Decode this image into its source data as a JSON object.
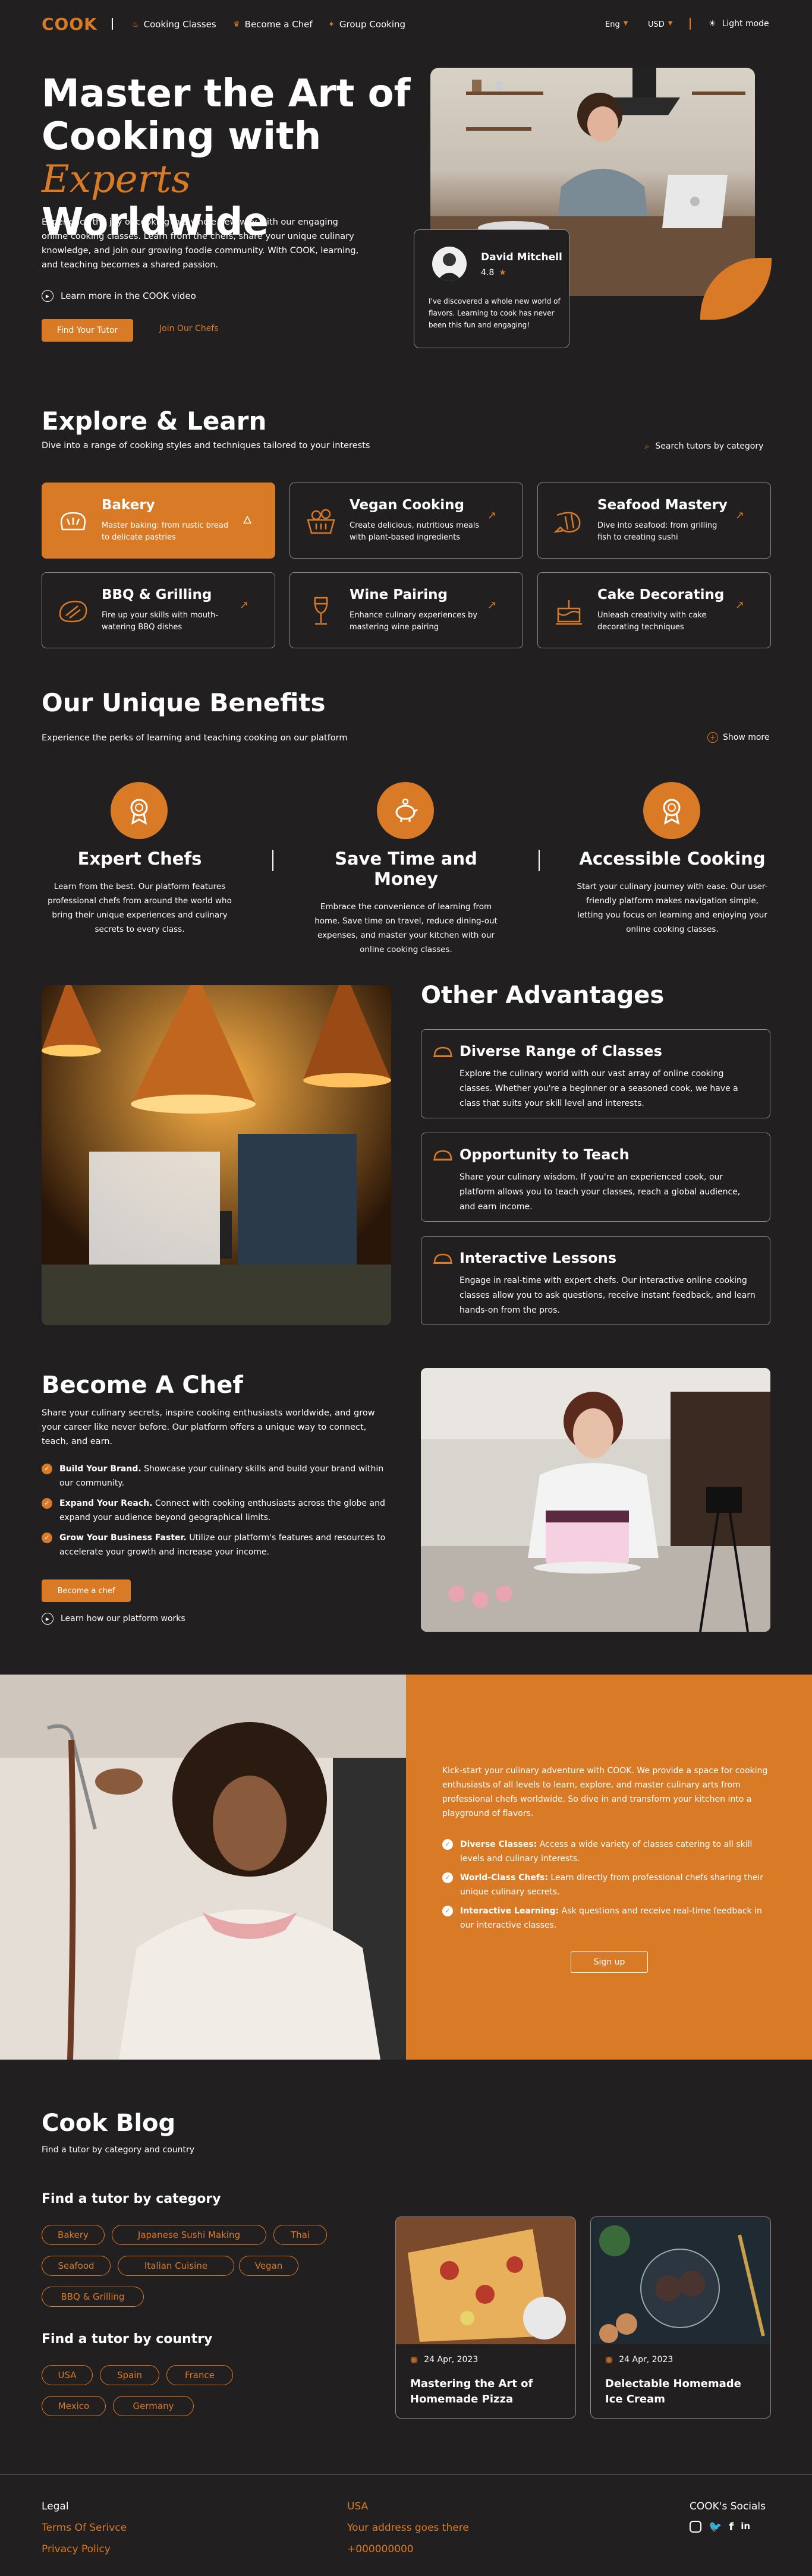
{
  "header": {
    "logo": "COOK",
    "nav": [
      "Cooking Classes",
      "Become a Chef",
      "Group Cooking"
    ],
    "lang": "Eng",
    "currency": "USD",
    "mode": "Light mode"
  },
  "hero": {
    "title_1": "Master the Art of",
    "title_2a": "Cooking with",
    "title_2b": "Experts",
    "title_3": "Worldwide",
    "desc": "Experience the joy of cooking in a whole new way with our engaging online cooking classes. Learn from the chefs, share your unique culinary knowledge, and join our growing foodie community. With COOK, learning, and teaching becomes a shared passion.",
    "video_link": "Learn more in the COOK video",
    "primary_btn": "Find Your Tutor",
    "secondary_btn": "Join Our Chefs",
    "review": {
      "name": "David Mitchell",
      "rating": "4.8",
      "text": "I've discovered a whole new world of flavors. Learning to cook has never been this fun and engaging!"
    }
  },
  "explore": {
    "title": "Explore & Learn",
    "subtitle": "Dive into a range of cooking styles and techniques tailored to your interests",
    "search": "Search tutors by category",
    "cards": [
      {
        "title": "Bakery",
        "desc": "Master baking: from rustic bread to delicate pastries",
        "icon": "bread-icon"
      },
      {
        "title": "Vegan Cooking",
        "desc": "Create delicious, nutritious meals with plant-based ingredients",
        "icon": "vegetable-basket-icon"
      },
      {
        "title": "Seafood Mastery",
        "desc": "Dive into seafood: from grilling fish to creating sushi",
        "icon": "shrimp-icon"
      },
      {
        "title": "BBQ & Grilling",
        "desc": "Fire up your skills with mouth-watering BBQ dishes",
        "icon": "steak-icon"
      },
      {
        "title": "Wine Pairing",
        "desc": "Enhance culinary experiences by mastering wine pairing",
        "icon": "wine-glass-icon"
      },
      {
        "title": "Cake Decorating",
        "desc": "Unleash creativity with cake decorating techniques",
        "icon": "cake-icon"
      }
    ]
  },
  "benefits": {
    "title": "Our Unique Benefits",
    "subtitle": "Experience the perks of learning and teaching cooking on our platform",
    "show_more": "Show more",
    "items": [
      {
        "title": "Expert Chefs",
        "desc": "Learn from the best. Our platform features professional chefs from around the world who bring their unique experiences and culinary secrets to every class."
      },
      {
        "title": "Save Time and Money",
        "desc": "Embrace the convenience of learning from home. Save time on travel, reduce dining-out expenses, and master your kitchen with our online cooking classes."
      },
      {
        "title": "Accessible Cooking",
        "desc": "Start your culinary journey with ease. Our user-friendly platform makes navigation simple, letting you focus on learning and enjoying your online cooking classes."
      }
    ]
  },
  "advantages": {
    "title": "Other Advantages",
    "items": [
      {
        "title": "Diverse Range of Classes",
        "desc": "Explore the culinary world with our vast array of online cooking classes. Whether you're a beginner or a seasoned cook, we have a class that suits your skill level and interests."
      },
      {
        "title": "Opportunity to Teach",
        "desc": "Share your culinary wisdom. If you're an experienced cook, our platform allows you to teach your classes, reach a global audience, and earn income."
      },
      {
        "title": "Interactive Lessons",
        "desc": "Engage in real-time with expert chefs. Our interactive online cooking classes allow you to ask questions, receive instant feedback, and learn hands-on from the pros."
      }
    ]
  },
  "become": {
    "title": "Become A Chef",
    "desc": "Share your culinary secrets, inspire cooking enthusiasts worldwide, and grow your career like never before. Our platform offers a unique way to connect, teach, and earn.",
    "bullets": [
      {
        "bold": "Build Your Brand.",
        "text": " Showcase your culinary skills and build your brand within our community."
      },
      {
        "bold": "Expand Your Reach.",
        "text": " Connect with cooking enthusiasts across the globe and expand your audience beyond geographical limits."
      },
      {
        "bold": "Grow Your Business Faster.",
        "text": " Utilize our platform's features and resources to accelerate your growth and increase your income."
      }
    ],
    "btn": "Become a chef",
    "link": "Learn how our platform works"
  },
  "signup": {
    "desc": "Kick-start your culinary adventure with COOK. We provide a space for cooking enthusiasts of all levels to learn, explore, and master culinary arts from professional chefs worldwide. So dive in and transform your kitchen into a playground of flavors.",
    "bullets": [
      {
        "bold": "Diverse Classes:",
        "text": " Access a wide variety of classes catering to all skill levels and culinary interests."
      },
      {
        "bold": "World-Class Chefs:",
        "text": " Learn directly from professional chefs sharing their unique culinary secrets."
      },
      {
        "bold": "Interactive Learning:",
        "text": " Ask questions and receive real-time feedback in our interactive classes."
      }
    ],
    "btn": "Sign up"
  },
  "blog": {
    "title": "Cook Blog",
    "subtitle": "Find a tutor by category and country",
    "cat_title": "Find a tutor by category",
    "categories": [
      "Bakery",
      "Japanese Sushi Making",
      "Thai",
      "Seafood",
      "Italian Cuisine",
      "Vegan",
      "BBQ & Grilling"
    ],
    "country_title": "Find a tutor by country",
    "countries": [
      "USA",
      "Spain",
      "France",
      "Mexico",
      "Germany"
    ],
    "posts": [
      {
        "date": "24 Apr, 2023",
        "title": "Mastering the Art of Homemade Pizza"
      },
      {
        "date": "24 Apr, 2023",
        "title": "Delectable Homemade Ice Cream"
      }
    ]
  },
  "footer": {
    "legal": "Legal",
    "terms": "Terms Of Serivce",
    "privacy": "Privacy Policy",
    "country": "USA",
    "address": "Your address goes there",
    "phone": "+000000000",
    "socials": "COOK's Socials"
  },
  "colors": {
    "accent": "#d97a27",
    "bg": "#211f1f"
  }
}
